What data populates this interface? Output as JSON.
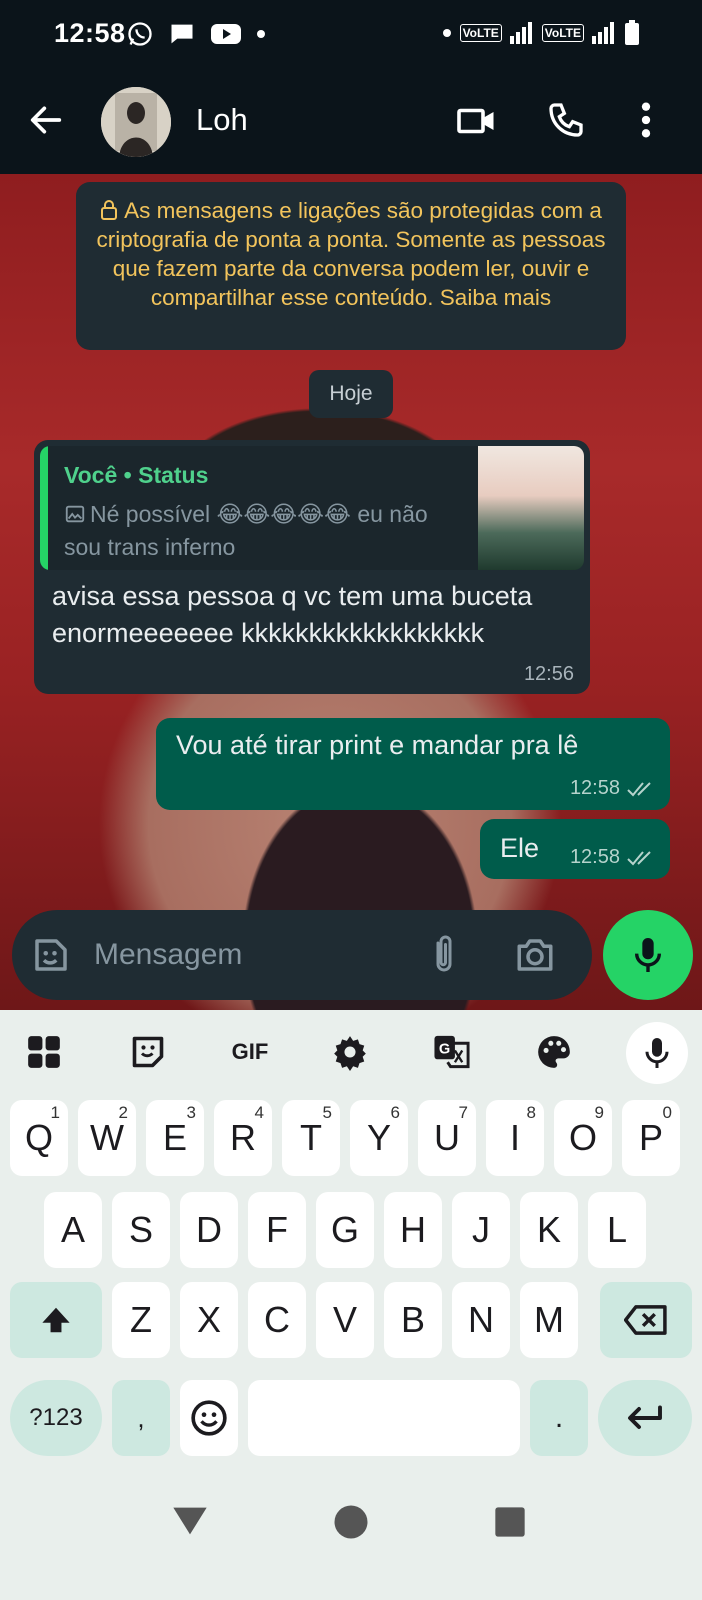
{
  "status_bar": {
    "time": "12:58",
    "volte1": "VoLTE",
    "volte2": "VoLTE"
  },
  "header": {
    "contact_name": "Loh"
  },
  "encryption_notice": "As mensagens e ligações são protegidas com a criptografia de ponta a ponta. Somente as pessoas que fazem parte da conversa podem ler, ouvir e compartilhar esse conteúdo. Saiba mais",
  "date_chip": "Hoje",
  "messages": [
    {
      "direction": "incoming",
      "quote_author": "Você • Status",
      "quote_text": "Né possível 😂😂😂😂😂 eu não sou trans inferno",
      "text": "avisa essa pessoa q vc tem uma buceta enormeeeeeee kkkkkkkkkkkkkkkkkk",
      "time": "12:56"
    },
    {
      "direction": "outgoing",
      "text": "Vou até tirar print e mandar  pra lê",
      "time": "12:58"
    },
    {
      "direction": "outgoing",
      "text": "Ele",
      "time": "12:58"
    }
  ],
  "composer": {
    "placeholder": "Mensagem"
  },
  "keyboard": {
    "toolbar": [
      "apps-icon",
      "sticker-icon",
      "GIF",
      "settings-icon",
      "translate-icon",
      "palette-icon",
      "mic-icon"
    ],
    "gif_label": "GIF",
    "row1": [
      {
        "k": "Q",
        "h": "1"
      },
      {
        "k": "W",
        "h": "2"
      },
      {
        "k": "E",
        "h": "3"
      },
      {
        "k": "R",
        "h": "4"
      },
      {
        "k": "T",
        "h": "5"
      },
      {
        "k": "Y",
        "h": "6"
      },
      {
        "k": "U",
        "h": "7"
      },
      {
        "k": "I",
        "h": "8"
      },
      {
        "k": "O",
        "h": "9"
      },
      {
        "k": "P",
        "h": "0"
      }
    ],
    "row2": [
      "A",
      "S",
      "D",
      "F",
      "G",
      "H",
      "J",
      "K",
      "L"
    ],
    "row3": [
      "Z",
      "X",
      "C",
      "V",
      "B",
      "N",
      "M"
    ],
    "symbols_key": "?123",
    "comma_key": ",",
    "period_key": "."
  },
  "colors": {
    "header_bg": "#0b141a",
    "incoming_bubble": "#1f2c33",
    "outgoing_bubble": "#005c4b",
    "accent_green": "#25d366",
    "notice_text": "#f2c45c"
  }
}
